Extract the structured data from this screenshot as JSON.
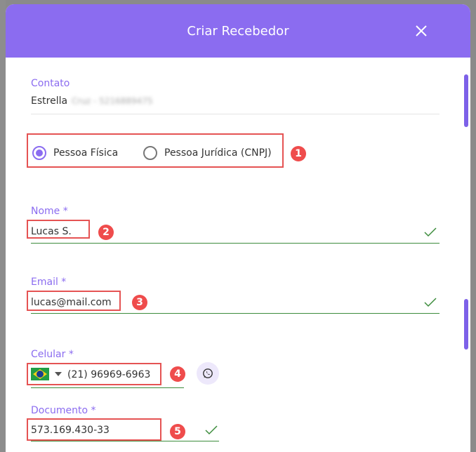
{
  "modal": {
    "title": "Criar Recebedor"
  },
  "contact": {
    "label": "Contato",
    "name": "Estrella",
    "blurred": "Cruz - 5216889475"
  },
  "person_type": {
    "options": [
      {
        "label": "Pessoa Física",
        "checked": true
      },
      {
        "label": "Pessoa Jurídica (CNPJ)",
        "checked": false
      }
    ]
  },
  "fields": {
    "nome": {
      "label": "Nome *",
      "value": "Lucas S."
    },
    "email": {
      "label": "Email *",
      "value": "lucas@mail.com"
    },
    "celular": {
      "label": "Celular *",
      "value": "(21) 96969-6963",
      "country": "BR"
    },
    "documento": {
      "label": "Documento *",
      "value": "573.169.430-33"
    }
  },
  "annotations": [
    "1",
    "2",
    "3",
    "4",
    "5"
  ],
  "colors": {
    "accent": "#8b6cf0",
    "valid": "#3c8c3c",
    "annotation": "#ef4c4c"
  },
  "icons": {
    "close": "close-icon",
    "check": "check-icon",
    "whatsapp": "whatsapp-icon",
    "flag": "brazil-flag-icon",
    "caret": "caret-down-icon"
  }
}
